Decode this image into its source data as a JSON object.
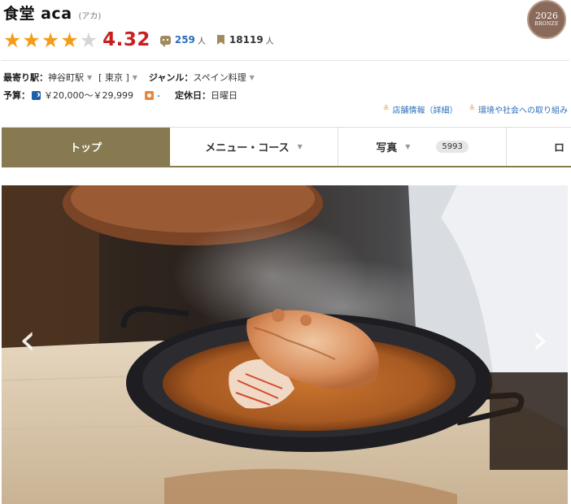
{
  "restaurant": {
    "name": "食堂 aca",
    "kana": "(アカ)"
  },
  "rating": {
    "score": "4.32",
    "stars_filled": 4,
    "stars_total": 5,
    "review_count": "259",
    "review_unit": "人",
    "bookmark_count": "18119",
    "bookmark_unit": "人"
  },
  "award": {
    "year": "2026",
    "rank": "BRONZE"
  },
  "info": {
    "station_label": "最寄り駅：",
    "station_value": "神谷町駅",
    "area_value": "[ 東京 ]",
    "genre_label": "ジャンル：",
    "genre_value": "スペイン料理",
    "budget_label": "予算：",
    "budget_dinner": "￥20,000～￥29,999",
    "budget_lunch": "-",
    "holiday_label": "定休日：",
    "holiday_value": "日曜日"
  },
  "links": [
    {
      "label": "店舗情報（詳細）"
    },
    {
      "label": "環境や社会への取り組み"
    }
  ],
  "tabs": [
    {
      "label": "トップ",
      "active": true
    },
    {
      "label": "メニュー・コース"
    },
    {
      "label": "写真",
      "badge": "5993"
    },
    {
      "label": "ロ"
    }
  ],
  "colors": {
    "star": "#f59b17",
    "score": "#c91e1e",
    "active_tab": "#877a50",
    "link": "#2c6fb7"
  },
  "icons": {
    "review": "comment-icon",
    "bookmark": "bookmark-icon",
    "dinner": "moon-icon",
    "lunch": "sun-icon",
    "link_arrow": "double-chevron-down-icon",
    "prev": "chevron-left-icon",
    "next": "chevron-right-icon"
  }
}
